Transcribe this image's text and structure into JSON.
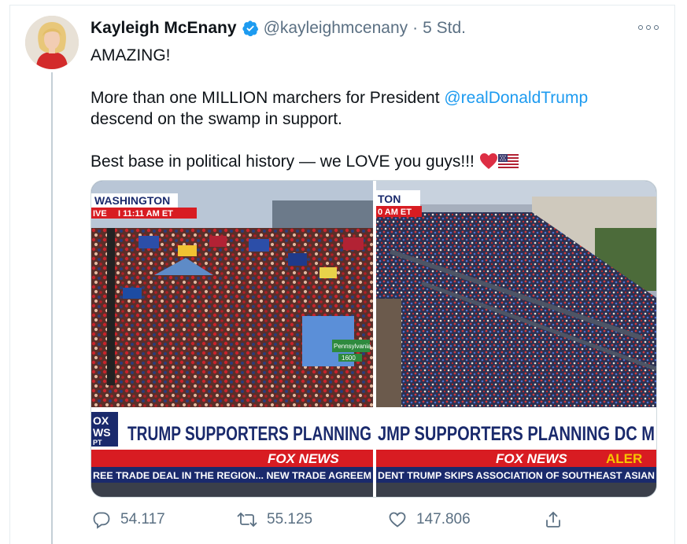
{
  "tweet": {
    "author_name": "Kayleigh McEnany",
    "handle": "@kayleighmcenany",
    "separator": "·",
    "time": "5 Std.",
    "text": {
      "line1": "AMAZING!",
      "line2_pre": "More than one MILLION marchers for President ",
      "line2_mention": "@realDonaldTrump",
      "line3": "descend on the swamp in support.",
      "line4": "Best base in political history — we LOVE you guys!!!"
    }
  },
  "media": {
    "left": {
      "location": "WASHINGTON",
      "live": "IVE",
      "live_time": "I 11:11 AM ET",
      "street_sign": "Pennsylvania",
      "street_sign_2": "1600",
      "headline": "TRUMP SUPPORTERS PLANNING",
      "brand": "FOX NEWS",
      "logo_top": "OX",
      "logo_mid": "WS",
      "logo_bottom": "PT",
      "ticker": "REE TRADE DEAL IN THE REGION... NEW TRADE AGREEM"
    },
    "right": {
      "location": "TON",
      "live_time": "0 AM ET",
      "headline": "JMP SUPPORTERS PLANNING DC M",
      "brand": "FOX NEWS",
      "alert": "ALER",
      "ticker": "DENT TRUMP SKIPS ASSOCIATION OF SOUTHEAST ASIAN"
    }
  },
  "actions": {
    "replies": "54.117",
    "retweets": "55.125",
    "likes": "147.806"
  },
  "icons": {
    "verified": "verified-badge-icon",
    "more": "more-options-icon",
    "reply": "reply-icon",
    "retweet": "retweet-icon",
    "like": "heart-icon",
    "share": "share-icon",
    "heart_emoji": "red-heart-emoji",
    "flag_emoji": "us-flag-emoji"
  },
  "colors": {
    "link": "#1d9bf0",
    "verified": "#1d9bf0",
    "secondary_text": "#5b7083",
    "fox_red": "#d81c22",
    "fox_blue": "#1a2a6c",
    "alert_yellow": "#f7c600"
  }
}
